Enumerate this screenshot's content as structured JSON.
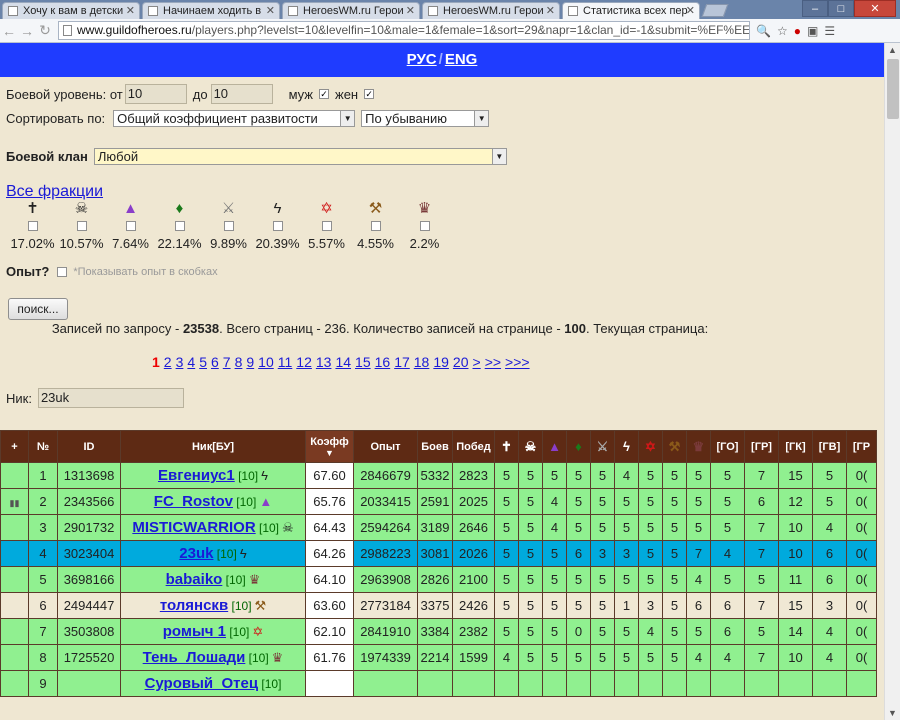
{
  "browser": {
    "tabs": [
      {
        "title": "Хочу к вам в детски",
        "active": false
      },
      {
        "title": "Начинаем ходить в",
        "active": false
      },
      {
        "title": "HeroesWM.ru Герои",
        "active": false
      },
      {
        "title": "HeroesWM.ru Герои",
        "active": false
      },
      {
        "title": "Статистика всех пер",
        "active": true
      }
    ],
    "url_host": "www.guildofheroes.ru",
    "url_rest": "/players.php?levelst=10&levelfin=10&male=1&female=1&sort=29&napr=1&clan_id=-1&submit=%EF%EE%"
  },
  "lang": {
    "rus": "РУС",
    "sep": "/",
    "eng": "ENG"
  },
  "filters": {
    "level_label": "Боевой уровень: от",
    "level_from": "10",
    "level_to_label": "до",
    "level_to": "10",
    "male_label": "муж",
    "female_label": "жен",
    "sort_label": "Сортировать по:",
    "sort_value": "Общий коэффициент развитости",
    "order_value": "По убыванию",
    "clan_label": "Боевой клан",
    "clan_value": "Любой",
    "all_fractions": "Все фракции",
    "exp_label": "Опыт?",
    "exp_hint": "*Показывать опыт в скобках",
    "search_button": "поиск...",
    "nick_label": "Ник:",
    "nick_value": "23uk"
  },
  "fractions": [
    {
      "icon": "cross-icon",
      "pct": "17.02%"
    },
    {
      "icon": "skull-icon",
      "pct": "10.57%"
    },
    {
      "icon": "wizard-hat-icon",
      "pct": "7.64%"
    },
    {
      "icon": "leaf-icon",
      "pct": "22.14%"
    },
    {
      "icon": "sword-icon",
      "pct": "9.89%"
    },
    {
      "icon": "dark-elf-icon",
      "pct": "20.39%"
    },
    {
      "icon": "pentagram-icon",
      "pct": "5.57%"
    },
    {
      "icon": "hammer-icon",
      "pct": "4.55%"
    },
    {
      "icon": "barbarian-icon",
      "pct": "2.2%"
    }
  ],
  "info": {
    "t1": "Записей по запросу - ",
    "total": "23538",
    "t2": ". Всего страниц - 236. Количество записей на странице - ",
    "per_page": "100",
    "t3": ". Текущая страница:"
  },
  "pages": [
    "1",
    "2",
    "3",
    "4",
    "5",
    "6",
    "7",
    "8",
    "9",
    "10",
    "11",
    "12",
    "13",
    "14",
    "15",
    "16",
    "17",
    "18",
    "19",
    "20",
    ">",
    ">>",
    ">>>"
  ],
  "table": {
    "headers": [
      "+",
      "№",
      "ID",
      "Ник[БУ]",
      "Коэфф",
      "Опыт",
      "Боев",
      "Побед",
      "",
      "",
      "",
      "",
      "",
      "",
      "",
      "",
      "",
      "[ГО]",
      "[ГР]",
      "[ГК]",
      "[ГВ]",
      "[ГР"
    ],
    "header_icons": [
      "cross-icon",
      "skull-icon",
      "wizard-hat-icon",
      "leaf-icon",
      "sword-icon",
      "dark-elf-icon",
      "pentagram-icon",
      "hammer-icon",
      "barbarian-icon"
    ],
    "rows": [
      {
        "plus": "",
        "n": "1",
        "id": "1313698",
        "nick": "Евгениус1",
        "lvl": "[10]",
        "ficon": "dark-elf-icon",
        "k": "67.60",
        "exp": "2846679",
        "b": "5332",
        "w": "2823",
        "f": [
          "5",
          "5",
          "5",
          "5",
          "5",
          "4",
          "5",
          "5",
          "5"
        ],
        "g": [
          "5",
          "7",
          "15",
          "5",
          "0("
        ],
        "style": "r"
      },
      {
        "plus": "chart-icon",
        "n": "2",
        "id": "2343566",
        "nick": "FC_Rostov",
        "lvl": "[10]",
        "ficon": "wizard-hat-icon",
        "k": "65.76",
        "exp": "2033415",
        "b": "2591",
        "w": "2025",
        "f": [
          "5",
          "5",
          "4",
          "5",
          "5",
          "5",
          "5",
          "5",
          "5"
        ],
        "g": [
          "5",
          "6",
          "12",
          "5",
          "0("
        ],
        "style": "r"
      },
      {
        "plus": "",
        "n": "3",
        "id": "2901732",
        "nick": "MISTICWARRIOR",
        "lvl": "[10]",
        "ficon": "skull-icon",
        "k": "64.43",
        "exp": "2594264",
        "b": "3189",
        "w": "2646",
        "f": [
          "5",
          "5",
          "4",
          "5",
          "5",
          "5",
          "5",
          "5",
          "5"
        ],
        "g": [
          "5",
          "7",
          "10",
          "4",
          "0("
        ],
        "style": "r"
      },
      {
        "plus": "",
        "n": "4",
        "id": "3023404",
        "nick": "23uk",
        "lvl": "[10]",
        "ficon": "dark-elf-icon",
        "k": "64.26",
        "exp": "2988223",
        "b": "3081",
        "w": "2026",
        "f": [
          "5",
          "5",
          "5",
          "6",
          "3",
          "3",
          "5",
          "5",
          "7"
        ],
        "g": [
          "4",
          "7",
          "10",
          "6",
          "0("
        ],
        "style": "hl"
      },
      {
        "plus": "",
        "n": "5",
        "id": "3698166",
        "nick": "babaiko",
        "lvl": "[10]",
        "ficon": "barbarian-icon",
        "k": "64.10",
        "exp": "2963908",
        "b": "2826",
        "w": "2100",
        "f": [
          "5",
          "5",
          "5",
          "5",
          "5",
          "5",
          "5",
          "5",
          "4"
        ],
        "g": [
          "5",
          "5",
          "11",
          "6",
          "0("
        ],
        "style": "r"
      },
      {
        "plus": "",
        "n": "6",
        "id": "2494447",
        "nick": "толянскв",
        "lvl": "[10]",
        "ficon": "hammer-icon",
        "k": "63.60",
        "exp": "2773184",
        "b": "3375",
        "w": "2426",
        "f": [
          "5",
          "5",
          "5",
          "5",
          "5",
          "1",
          "3",
          "5",
          "6"
        ],
        "g": [
          "6",
          "7",
          "15",
          "3",
          "0("
        ],
        "style": "alt"
      },
      {
        "plus": "",
        "n": "7",
        "id": "3503808",
        "nick": "ромыч 1",
        "lvl": "[10]",
        "ficon": "pentagram-icon",
        "k": "62.10",
        "exp": "2841910",
        "b": "3384",
        "w": "2382",
        "f": [
          "5",
          "5",
          "5",
          "0",
          "5",
          "5",
          "4",
          "5",
          "5"
        ],
        "g": [
          "6",
          "5",
          "14",
          "4",
          "0("
        ],
        "style": "r"
      },
      {
        "plus": "",
        "n": "8",
        "id": "1725520",
        "nick": "Тень_Лошади",
        "lvl": "[10]",
        "ficon": "barbarian-icon",
        "k": "61.76",
        "exp": "1974339",
        "b": "2214",
        "w": "1599",
        "f": [
          "4",
          "5",
          "5",
          "5",
          "5",
          "5",
          "5",
          "5",
          "4"
        ],
        "g": [
          "4",
          "7",
          "10",
          "4",
          "0("
        ],
        "style": "r"
      },
      {
        "plus": "",
        "n": "9",
        "id": "",
        "nick": "Суровый_Отец",
        "lvl": "[10]",
        "ficon": "",
        "k": "",
        "exp": "",
        "b": "",
        "w": "",
        "f": [
          "",
          "",
          "",
          "",
          "",
          "",
          "",
          "",
          ""
        ],
        "g": [
          "",
          "",
          "",
          "",
          ""
        ],
        "style": "r"
      }
    ]
  }
}
